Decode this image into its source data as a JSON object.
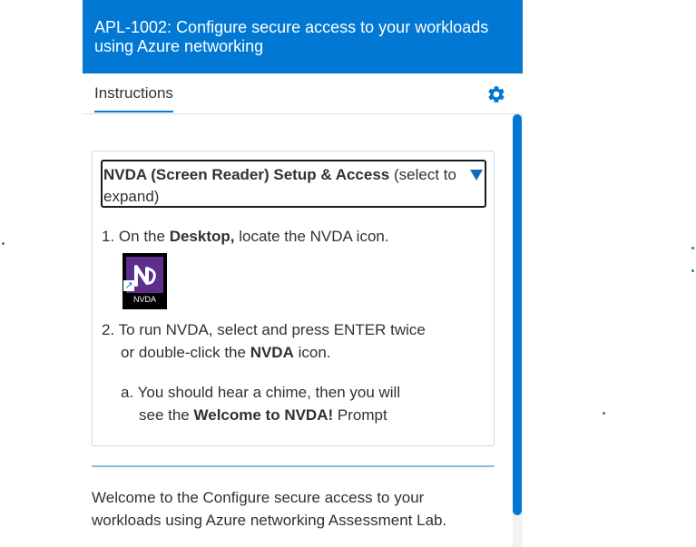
{
  "header": {
    "title": "APL-1002: Configure secure access to your workloads using Azure networking"
  },
  "tabs": {
    "instructions_label": "Instructions",
    "settings_icon": "gear-icon"
  },
  "colors": {
    "accent": "#0078d4",
    "header_bg": "#0078d4",
    "text": "#323130",
    "divider": "#89bfdc"
  },
  "accordion": {
    "summary_bold": "NVDA (Screen Reader) Setup & Access",
    "summary_rest": " (select to expand)",
    "steps": [
      {
        "number": "1.",
        "pre": "On the ",
        "bold": "Desktop,",
        "post": " locate the NVDA icon."
      },
      {
        "number": "2.",
        "line1": "To run NVDA, select and press ENTER twice",
        "line2_pre": "or double-click the ",
        "line2_bold": "NVDA",
        "line2_post": " icon."
      }
    ],
    "substep": {
      "letter": "a.",
      "line1": "You should hear a chime, then you will",
      "line2_pre": "see the ",
      "line2_bold": "Welcome to NVDA!",
      "line2_post": " Prompt"
    },
    "nvda_icon_label": "NVDA"
  },
  "welcome_text": "Welcome to the Configure secure access to your workloads using Azure networking Assessment Lab."
}
